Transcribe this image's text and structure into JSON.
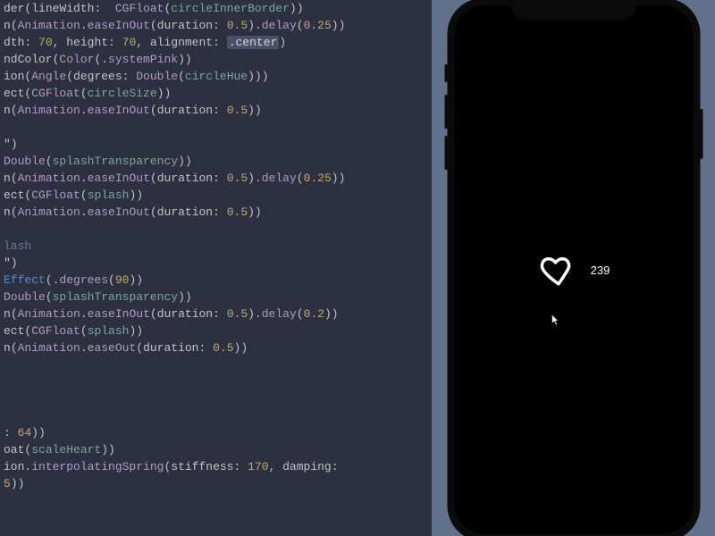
{
  "editor": {
    "lines": [
      [
        {
          "t": "der",
          "c": "base"
        },
        {
          "t": "(",
          "c": "base"
        },
        {
          "t": "lineWidth",
          "c": "base"
        },
        {
          "t": ":  ",
          "c": "base"
        },
        {
          "t": "CGFloat",
          "c": "func"
        },
        {
          "t": "(",
          "c": "base"
        },
        {
          "t": "circleInnerBorder",
          "c": "ident"
        },
        {
          "t": "))",
          "c": "base"
        }
      ],
      [
        {
          "t": "n",
          "c": "base"
        },
        {
          "t": "(",
          "c": "base"
        },
        {
          "t": "Animation",
          "c": "func"
        },
        {
          "t": ".",
          "c": "base"
        },
        {
          "t": "easeInOut",
          "c": "func"
        },
        {
          "t": "(",
          "c": "base"
        },
        {
          "t": "duration",
          "c": "base"
        },
        {
          "t": ": ",
          "c": "base"
        },
        {
          "t": "0.5",
          "c": "lit"
        },
        {
          "t": ").",
          "c": "base"
        },
        {
          "t": "delay",
          "c": "func"
        },
        {
          "t": "(",
          "c": "base"
        },
        {
          "t": "0.25",
          "c": "lit"
        },
        {
          "t": "))",
          "c": "base"
        }
      ],
      [
        {
          "t": "dth",
          "c": "base"
        },
        {
          "t": ": ",
          "c": "base"
        },
        {
          "t": "70",
          "c": "lit"
        },
        {
          "t": ", ",
          "c": "base"
        },
        {
          "t": "height",
          "c": "base"
        },
        {
          "t": ": ",
          "c": "base"
        },
        {
          "t": "70",
          "c": "lit"
        },
        {
          "t": ", ",
          "c": "base"
        },
        {
          "t": "alignment",
          "c": "base"
        },
        {
          "t": ": ",
          "c": "base"
        },
        {
          "t": ".center",
          "c": "str-hi"
        },
        {
          "t": ")",
          "c": "base"
        }
      ],
      [
        {
          "t": "ndColor",
          "c": "base"
        },
        {
          "t": "(",
          "c": "base"
        },
        {
          "t": "Color",
          "c": "func"
        },
        {
          "t": "(.",
          "c": "base"
        },
        {
          "t": "systemPink",
          "c": "func"
        },
        {
          "t": "))",
          "c": "base"
        }
      ],
      [
        {
          "t": "ion",
          "c": "base"
        },
        {
          "t": "(",
          "c": "base"
        },
        {
          "t": "Angle",
          "c": "func"
        },
        {
          "t": "(",
          "c": "base"
        },
        {
          "t": "degrees",
          "c": "base"
        },
        {
          "t": ": ",
          "c": "base"
        },
        {
          "t": "Double",
          "c": "func"
        },
        {
          "t": "(",
          "c": "base"
        },
        {
          "t": "circleHue",
          "c": "ident"
        },
        {
          "t": ")))",
          "c": "base"
        }
      ],
      [
        {
          "t": "ect",
          "c": "base"
        },
        {
          "t": "(",
          "c": "base"
        },
        {
          "t": "CGFloat",
          "c": "func"
        },
        {
          "t": "(",
          "c": "base"
        },
        {
          "t": "circleSize",
          "c": "ident"
        },
        {
          "t": "))",
          "c": "base"
        }
      ],
      [
        {
          "t": "n",
          "c": "base"
        },
        {
          "t": "(",
          "c": "base"
        },
        {
          "t": "Animation",
          "c": "func"
        },
        {
          "t": ".",
          "c": "base"
        },
        {
          "t": "easeInOut",
          "c": "func"
        },
        {
          "t": "(",
          "c": "base"
        },
        {
          "t": "duration",
          "c": "base"
        },
        {
          "t": ": ",
          "c": "base"
        },
        {
          "t": "0.5",
          "c": "lit"
        },
        {
          "t": "))",
          "c": "base"
        }
      ],
      [],
      [
        {
          "t": "\")",
          "c": "base"
        }
      ],
      [
        {
          "t": "Double",
          "c": "func"
        },
        {
          "t": "(",
          "c": "base"
        },
        {
          "t": "splashTransparency",
          "c": "ident"
        },
        {
          "t": "))",
          "c": "base"
        }
      ],
      [
        {
          "t": "n",
          "c": "base"
        },
        {
          "t": "(",
          "c": "base"
        },
        {
          "t": "Animation",
          "c": "func"
        },
        {
          "t": ".",
          "c": "base"
        },
        {
          "t": "easeInOut",
          "c": "func"
        },
        {
          "t": "(",
          "c": "base"
        },
        {
          "t": "duration",
          "c": "base"
        },
        {
          "t": ": ",
          "c": "base"
        },
        {
          "t": "0.5",
          "c": "lit"
        },
        {
          "t": ").",
          "c": "base"
        },
        {
          "t": "delay",
          "c": "func"
        },
        {
          "t": "(",
          "c": "base"
        },
        {
          "t": "0.25",
          "c": "lit"
        },
        {
          "t": "))",
          "c": "base"
        }
      ],
      [
        {
          "t": "ect",
          "c": "base"
        },
        {
          "t": "(",
          "c": "base"
        },
        {
          "t": "CGFloat",
          "c": "func"
        },
        {
          "t": "(",
          "c": "base"
        },
        {
          "t": "splash",
          "c": "ident"
        },
        {
          "t": "))",
          "c": "base"
        }
      ],
      [
        {
          "t": "n",
          "c": "base"
        },
        {
          "t": "(",
          "c": "base"
        },
        {
          "t": "Animation",
          "c": "func"
        },
        {
          "t": ".",
          "c": "base"
        },
        {
          "t": "easeInOut",
          "c": "func"
        },
        {
          "t": "(",
          "c": "base"
        },
        {
          "t": "duration",
          "c": "base"
        },
        {
          "t": ": ",
          "c": "base"
        },
        {
          "t": "0.5",
          "c": "lit"
        },
        {
          "t": "))",
          "c": "base"
        }
      ],
      [],
      [
        {
          "t": "lash",
          "c": "comment"
        }
      ],
      [
        {
          "t": "\")",
          "c": "base"
        }
      ],
      [
        {
          "t": "Effect",
          "c": "kw"
        },
        {
          "t": "(.",
          "c": "base"
        },
        {
          "t": "degrees",
          "c": "func"
        },
        {
          "t": "(",
          "c": "base"
        },
        {
          "t": "90",
          "c": "lit"
        },
        {
          "t": "))",
          "c": "base"
        }
      ],
      [
        {
          "t": "Double",
          "c": "func"
        },
        {
          "t": "(",
          "c": "base"
        },
        {
          "t": "splashTransparency",
          "c": "ident"
        },
        {
          "t": "))",
          "c": "base"
        }
      ],
      [
        {
          "t": "n",
          "c": "base"
        },
        {
          "t": "(",
          "c": "base"
        },
        {
          "t": "Animation",
          "c": "func"
        },
        {
          "t": ".",
          "c": "base"
        },
        {
          "t": "easeInOut",
          "c": "func"
        },
        {
          "t": "(",
          "c": "base"
        },
        {
          "t": "duration",
          "c": "base"
        },
        {
          "t": ": ",
          "c": "base"
        },
        {
          "t": "0.5",
          "c": "lit"
        },
        {
          "t": ").",
          "c": "base"
        },
        {
          "t": "delay",
          "c": "func"
        },
        {
          "t": "(",
          "c": "base"
        },
        {
          "t": "0.2",
          "c": "lit"
        },
        {
          "t": "))",
          "c": "base"
        }
      ],
      [
        {
          "t": "ect",
          "c": "base"
        },
        {
          "t": "(",
          "c": "base"
        },
        {
          "t": "CGFloat",
          "c": "func"
        },
        {
          "t": "(",
          "c": "base"
        },
        {
          "t": "splash",
          "c": "ident"
        },
        {
          "t": "))",
          "c": "base"
        }
      ],
      [
        {
          "t": "n",
          "c": "base"
        },
        {
          "t": "(",
          "c": "base"
        },
        {
          "t": "Animation",
          "c": "func"
        },
        {
          "t": ".",
          "c": "base"
        },
        {
          "t": "easeOut",
          "c": "func"
        },
        {
          "t": "(",
          "c": "base"
        },
        {
          "t": "duration",
          "c": "base"
        },
        {
          "t": ": ",
          "c": "base"
        },
        {
          "t": "0.5",
          "c": "lit"
        },
        {
          "t": "))",
          "c": "base"
        }
      ],
      [],
      [],
      [],
      [],
      [
        {
          "t": ": ",
          "c": "base"
        },
        {
          "t": "64",
          "c": "lit"
        },
        {
          "t": "))",
          "c": "base"
        }
      ],
      [
        {
          "t": "oat",
          "c": "base"
        },
        {
          "t": "(",
          "c": "base"
        },
        {
          "t": "scaleHeart",
          "c": "ident"
        },
        {
          "t": "))",
          "c": "base"
        }
      ],
      [
        {
          "t": "ion",
          "c": "base"
        },
        {
          "t": ".",
          "c": "base"
        },
        {
          "t": "interpolatingSpring",
          "c": "func"
        },
        {
          "t": "(",
          "c": "base"
        },
        {
          "t": "stiffness",
          "c": "base"
        },
        {
          "t": ": ",
          "c": "base"
        },
        {
          "t": "170",
          "c": "lit"
        },
        {
          "t": ", ",
          "c": "base"
        },
        {
          "t": "damping",
          "c": "base"
        },
        {
          "t": ":",
          "c": "base"
        }
      ],
      [
        {
          "t": "5",
          "c": "lit"
        },
        {
          "t": "))",
          "c": "base"
        }
      ]
    ]
  },
  "preview": {
    "like_count": "239"
  }
}
